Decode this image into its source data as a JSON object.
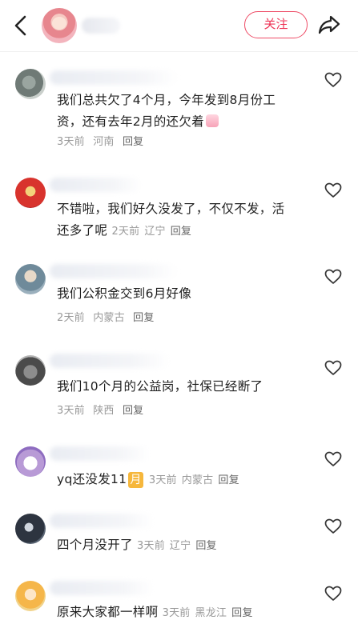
{
  "header": {
    "follow_label": "关注",
    "accent_color": "#ee3355"
  },
  "comments": [
    {
      "text": "我们总共欠了4个月，今年发到8月份工资，还有去年2月的还欠着",
      "emoji": "bathing-emoji",
      "time": "3天前",
      "location": "河南",
      "reply": "回复"
    },
    {
      "text": "不错啦，我们好久没发了，不仅不发，活还多了呢",
      "time": "2天前",
      "location": "辽宁",
      "reply": "回复"
    },
    {
      "text": "我们公积金交到6月好像",
      "time": "2天前",
      "location": "内蒙古",
      "reply": "回复"
    },
    {
      "text": "我们10个月的公益岗，社保已经断了",
      "time": "3天前",
      "location": "陕西",
      "reply": "回复"
    },
    {
      "text": "yq还没发11",
      "chip": "月",
      "time": "3天前",
      "location": "内蒙古",
      "reply": "回复"
    },
    {
      "text": "四个月没开了",
      "time": "3天前",
      "location": "辽宁",
      "reply": "回复"
    },
    {
      "text": "原来大家都一样啊",
      "time": "3天前",
      "location": "黑龙江",
      "reply": "回复"
    }
  ]
}
